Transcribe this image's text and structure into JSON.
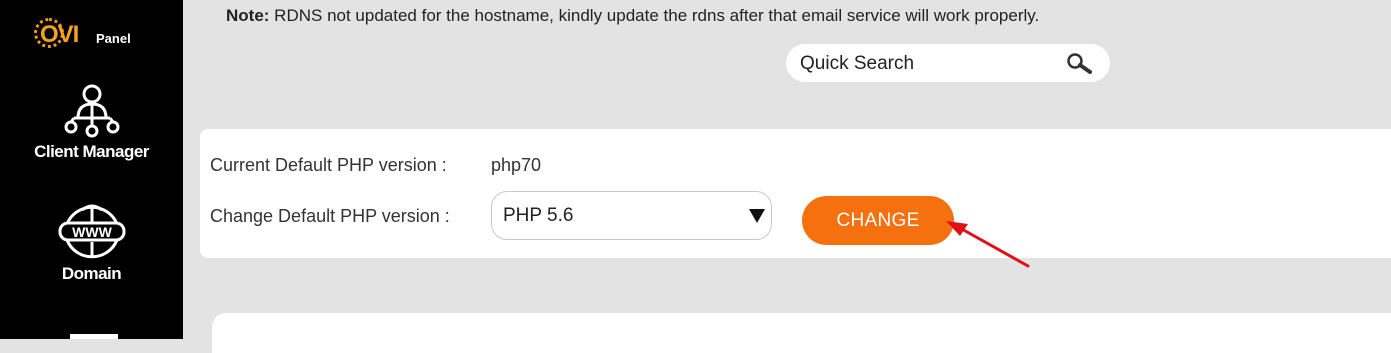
{
  "sidebar": {
    "logo": {
      "brand": "OVI",
      "suffix": "Panel"
    },
    "items": [
      {
        "label": "Client Manager",
        "icon": "network-hierarchy-icon"
      },
      {
        "label": "Domain",
        "icon": "www-globe-icon"
      }
    ]
  },
  "notice": {
    "prefix": "Note:",
    "text": " RDNS not updated for the hostname, kindly update the rdns after that email service will work properly."
  },
  "search": {
    "placeholder": "Quick Search",
    "icon": "search-icon"
  },
  "php": {
    "current_label": "Current Default PHP version :",
    "current_value": "php70",
    "change_label": "Change Default PHP version :",
    "selected": "PHP 5.6",
    "button": "CHANGE"
  },
  "colors": {
    "sidebar_bg": "#000000",
    "accent": "#f5700f",
    "logo_orange": "#f7a21b",
    "annotation_arrow": "#e0101a",
    "page_bg": "#e3e3e3"
  }
}
